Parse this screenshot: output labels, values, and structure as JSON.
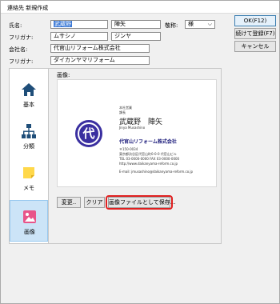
{
  "window": {
    "title": "連絡先 新規作成"
  },
  "form": {
    "name_label": "氏名:",
    "last_name": "武蔵野",
    "first_name": "陣矢",
    "honorific_label": "敬称:",
    "honorific_value": "様",
    "furigana_label": "フリガナ:",
    "last_furigana": "ムサシノ",
    "first_furigana": "ジンヤ",
    "company_label": "会社名:",
    "company_value": "代官山リフォーム株式会社",
    "company_furigana_label": "フリガナ:",
    "company_furigana_value": "ダイカンヤマリフォーム"
  },
  "actions": {
    "ok": "OK(F12)",
    "save_continue": "続けて登録(F7)",
    "cancel": "キャンセル"
  },
  "sidebar": {
    "items": [
      {
        "label": "基本",
        "icon": "home-icon"
      },
      {
        "label": "分類",
        "icon": "hierarchy-icon"
      },
      {
        "label": "メモ",
        "icon": "sticky-note-icon"
      },
      {
        "label": "画像",
        "icon": "image-icon",
        "active": true
      }
    ]
  },
  "image_panel": {
    "label": "画像:",
    "buttons": {
      "change": "変更..",
      "clear": "クリア",
      "save_as_file": "画像ファイルとして保存..."
    }
  },
  "business_card": {
    "dept_line1": "本社営業",
    "dept_line2": "課長",
    "person_name": "武蔵野　陣矢",
    "person_romaji": "Jinya Musashino",
    "logo_char": "代",
    "company": "代官山リフォーム株式会社",
    "address1": "〒150-0034",
    "address2": "東京都渋谷区代官山町0-0-0 代官山ビル",
    "tel": "TEL 03-0000-0000  FAX 03-0000-0000",
    "url": "http://www.daikanyama-reform.co.jp",
    "email": "E-mail: jmusashino@daikanyama-reform.co.jp"
  }
}
